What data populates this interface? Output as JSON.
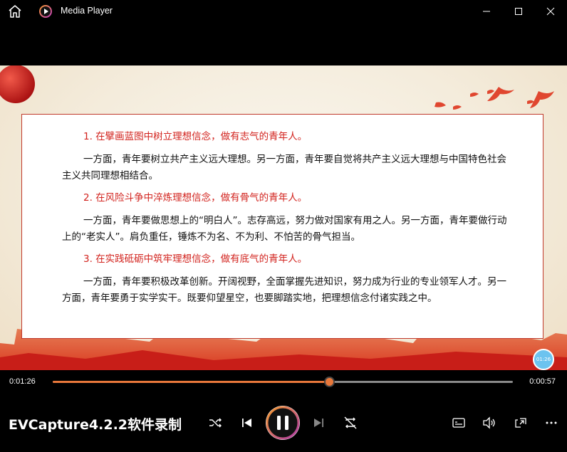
{
  "window": {
    "title": "Media Player"
  },
  "slide": {
    "paragraphs": [
      {
        "style": "red",
        "text": "1. 在擘画蓝图中树立理想信念，做有志气的青年人。"
      },
      {
        "style": "body",
        "text": "一方面，青年要树立共产主义远大理想。另一方面，青年要自觉将共产主义远大理想与中国特色社会主义共同理想相结合。"
      },
      {
        "style": "red",
        "text": "2. 在风险斗争中淬炼理想信念，做有骨气的青年人。"
      },
      {
        "style": "body",
        "text": "一方面，青年要做思想上的“明白人”。志存高远，努力做对国家有用之人。另一方面，青年要做行动上的“老实人”。肩负重任，锤炼不为名、不为利、不怕苦的骨气担当。"
      },
      {
        "style": "red",
        "text": "3. 在实践砥砺中筑牢理想信念，做有底气的青年人。"
      },
      {
        "style": "body",
        "text": "一方面，青年要积极改革创新。开阔视野，全面掌握先进知识，努力成为行业的专业领军人才。另一方面，青年要勇于实学实干。既要仰望星空，也要脚踏实地，把理想信念付诸实践之中。"
      }
    ],
    "bubble_time": "01:26"
  },
  "playback": {
    "current_time": "0:01:26",
    "remaining_time": "0:00:57",
    "progress_fraction": 0.6
  },
  "watermark": "EVCapture4.2.2软件录制",
  "colors": {
    "accent": "#e8773a",
    "slide_red": "#d2231e",
    "track": "#8a8a8a"
  },
  "icons": {
    "home": "home-icon",
    "app": "media-player-icon",
    "minimize": "minimize-icon",
    "maximize": "maximize-icon",
    "close": "close-icon",
    "shuffle": "shuffle-icon",
    "previous": "previous-icon",
    "pause": "pause-icon",
    "next": "next-icon",
    "repeat": "repeat-off-icon",
    "captions": "captions-icon",
    "volume": "volume-icon",
    "miniplayer": "mini-player-icon",
    "more": "more-icon"
  }
}
